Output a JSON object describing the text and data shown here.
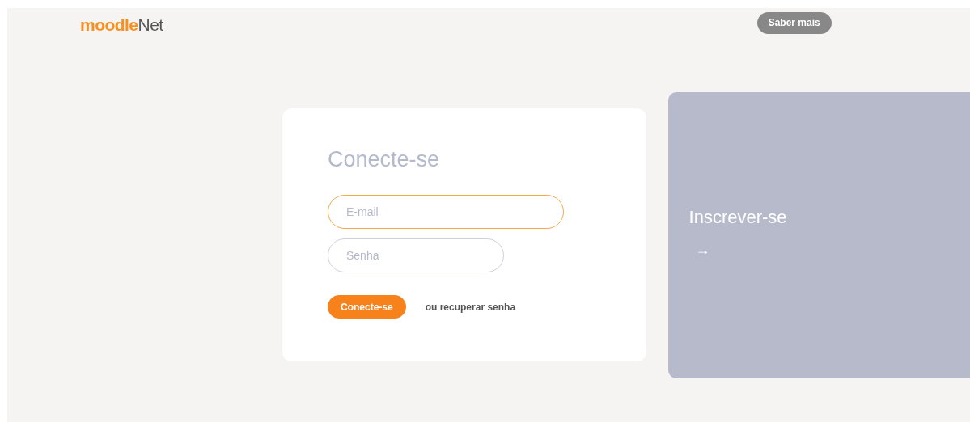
{
  "header": {
    "logo": {
      "brand": "moodle",
      "suffix": "Net"
    },
    "button": "Saber mais"
  },
  "login": {
    "title": "Conecte-se",
    "fields": [
      {
        "placeholder": "E-mail",
        "focused": true
      },
      {
        "placeholder": "Senha",
        "focused": false
      }
    ],
    "submit": "Conecte-se",
    "recover_link": "ou recuperar senha"
  },
  "signup": {
    "title": "Inscrever-se",
    "arrow": "→"
  }
}
